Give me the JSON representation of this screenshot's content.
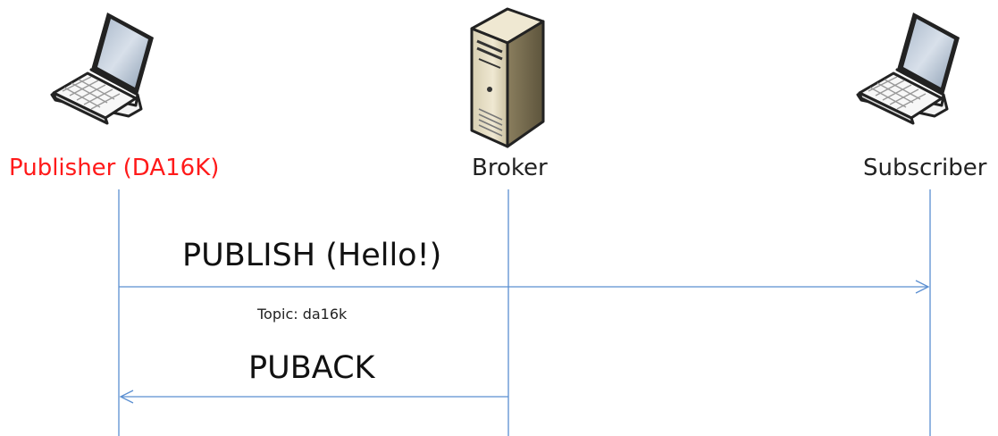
{
  "participants": [
    {
      "id": "publisher",
      "label": "Publisher (DA16K)",
      "icon": "laptop-icon",
      "highlight": true
    },
    {
      "id": "broker",
      "label": "Broker",
      "icon": "server-icon",
      "highlight": false
    },
    {
      "id": "subscriber",
      "label": "Subscriber",
      "icon": "laptop-icon",
      "highlight": false
    }
  ],
  "messages": [
    {
      "id": "publish",
      "from": "publisher",
      "to": "subscriber",
      "label": "PUBLISH (Hello!)",
      "sublabel": "Topic: da16k"
    },
    {
      "id": "puback",
      "from": "broker",
      "to": "publisher",
      "label": "PUBACK"
    }
  ],
  "colors": {
    "lifeline": "#5b8fd1",
    "highlight_label": "#ff1a1a",
    "text": "#222222"
  }
}
